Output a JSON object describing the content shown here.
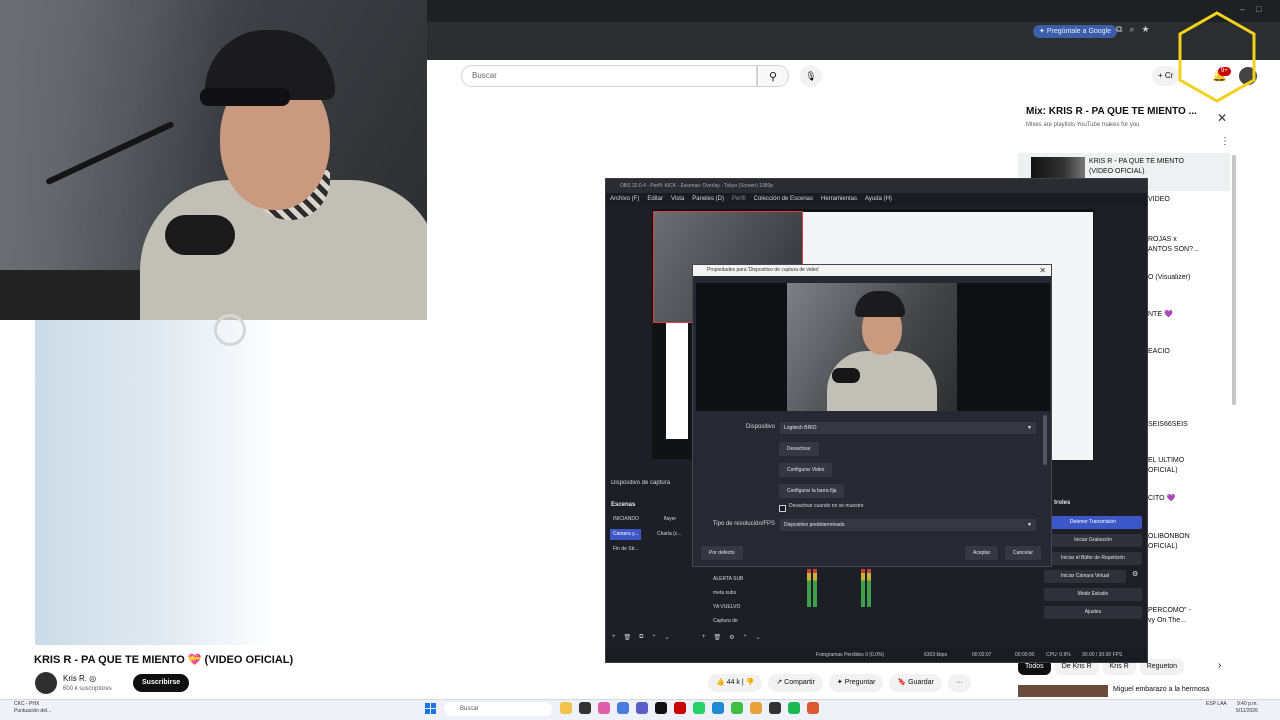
{
  "browser": {
    "ask_google": "Pregúntale a Google",
    "window_controls": [
      "–",
      "□",
      "✕"
    ]
  },
  "youtube": {
    "search_placeholder": "Buscar",
    "create_label": "Cr",
    "notification_count": "9+",
    "video_title": "KRIS R - PA QUE TE MIENTO 💝 (VIDEO OFICIAL)",
    "channel_name": "Kris R. ◎",
    "subscriber_count": "600 k suscriptores",
    "subscribe_label": "Suscribirse",
    "actions": {
      "likes": "44 k",
      "share": "Compartir",
      "ask": "Preguntar",
      "save": "Guardar",
      "more": "···"
    },
    "mix": {
      "title": "Mix: KRIS R - PA QUE TE MIENTO ...",
      "subtitle": "Mixes are playlists YouTube makes for you",
      "row_title": "KRIS R - PA QUE TE MIENTO (VIDEO OFICIAL)"
    },
    "sidebar_fragments": [
      "VIDEO",
      "ROJAS x",
      "ANTOS SON?...",
      "O (Visualizer)",
      "NTE 💜",
      "EACIO",
      "SEIS66SEIS",
      "EL ULTIMO",
      "OFICIAL)",
      "CITO 💜",
      "OLIBONBON",
      "OFICIAL)",
      "PERCOMO\" -",
      "vy On The..."
    ],
    "chips": [
      "Todos",
      "De Kris R",
      "Kris R",
      "Regueton"
    ],
    "next_video_title": "Miguel embarazo a la hermosa"
  },
  "obs": {
    "title": "OBS 32.0.4 - Perfil: KICK - Escenas: Overlay - Tokyo (Screen) 1080p",
    "menu": [
      "Archivo (F)",
      "Editar",
      "Vista",
      "Paneles (D)",
      "Perfil",
      "Colección de Escenas",
      "Herramientas",
      "Ayuda (H)"
    ],
    "source_label": "Dispositivo de captura",
    "scenes_header": "Escenas",
    "scenes": [
      "INICIANDO",
      "flayer",
      "Camara y...",
      "Charla (c...",
      "Fin de Str..."
    ],
    "sources": [
      "ALERTA SUB",
      "meta subs",
      "YA VUELVO",
      "Captura de"
    ],
    "controls_header": "troles",
    "controls": [
      "Detener Transmisión",
      "Iniciar Grabación",
      "Iniciar el Búfer de Repetición",
      "Iniciar Cámara Virtual",
      "Modo Estudio",
      "Ajustes"
    ],
    "status": {
      "dropped": "Fotogramas Perdidos 0 (0.0%)",
      "bitrate": "6303 kbps",
      "stream_time": "00:02:07",
      "rec_time": "00:00:00",
      "cpu": "CPU: 0.9%",
      "fps": "30.00 / 30.00 FPS"
    }
  },
  "dialog": {
    "title": "Propiedades para 'Dispositivo de captura de video'",
    "device_label": "Dispositivo",
    "device_value": "Logitech BRIO",
    "deactivate": "Desactivar",
    "configure_video": "Configurar Video",
    "configure_crossbar": "Configurar la barra fija",
    "deactivate_hidden": "Desactivar cuando no se muestre",
    "res_label": "Tipo de resolución/FPS",
    "res_value": "Dispositivo predeterminado",
    "defaults": "Por defecto",
    "accept": "Aceptar",
    "cancel": "Cancelar"
  },
  "taskbar": {
    "notif_line1": "CKC - PHX",
    "notif_line2": "Puntuación del...",
    "search": "Buscar",
    "lang": "ESP LAA",
    "time": "9:40 p.m.",
    "date": "5/11/2026"
  },
  "colors": {
    "obs_primary": "#3c57c7",
    "yt_red": "#cc0000",
    "hex_overlay": "#f2d21a"
  }
}
